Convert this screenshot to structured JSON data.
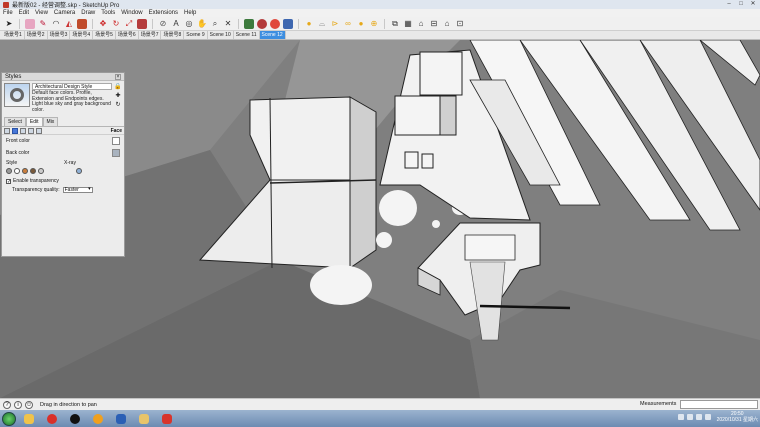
{
  "window": {
    "title": "最新版02 - 经营调整.skp - SketchUp Pro",
    "controls": [
      "–",
      "□",
      "✕"
    ]
  },
  "menu": [
    "File",
    "Edit",
    "View",
    "Camera",
    "Draw",
    "Tools",
    "Window",
    "Extensions",
    "Help"
  ],
  "toolbar": {
    "icons": [
      "select-icon",
      "eraser-icon",
      "pencil-icon",
      "arc-icon",
      "paint-icon",
      "push-pull-icon",
      "move-icon",
      "rotate-icon",
      "scale-icon",
      "offset-icon",
      "tape-icon",
      "text-icon",
      "orbit-icon",
      "pan-icon",
      "zoom-icon",
      "zoom-extents-icon",
      "component-icon",
      "warehouse-icon",
      "extension-icon",
      "iso-view-icon",
      "top-view-icon",
      "front-view-icon",
      "right-view-icon",
      "back-view-icon",
      "left-view-icon"
    ]
  },
  "scenes": {
    "tabs": [
      "场景号1",
      "场景号2",
      "场景号3",
      "场景号4",
      "场景号5",
      "场景号6",
      "场景号7",
      "场景号8",
      "Scene 9",
      "Scene 10",
      "Scene 11",
      "Scene 12"
    ],
    "active_index": 11
  },
  "styles_panel": {
    "header": "Styles",
    "style_name": "Architectural Design Style",
    "style_description": "Default face colors. Profile, Extension and Endpoints edges. Light blue sky and gray background color.",
    "tabs": [
      "Select",
      "Edit",
      "Mix"
    ],
    "active_tab": "Edit",
    "section_label": "Face",
    "front_color_label": "Front color",
    "back_color_label": "Back color",
    "front_color": "#ffffff",
    "back_color": "#a9b3bf",
    "style_label": "Style",
    "xray_label": "X-ray",
    "transparency_label": "Enable transparency",
    "transparency_checked": true,
    "quality_label": "Transparency quality:",
    "quality_value": "Faster"
  },
  "status": {
    "hint": "Drag in direction to pan",
    "measurements_label": "Measurements",
    "measurements_value": ""
  },
  "taskbar": {
    "apps": [
      "explorer",
      "browser-red",
      "qq",
      "orange",
      "word",
      "folder",
      "sketchup"
    ],
    "time": "20:50",
    "date": "2020/10/31 星期六"
  },
  "colors": {
    "viewport_bg": "#7f7f7f",
    "active_tab": "#3d8ee0",
    "face_white": "#ffffff"
  }
}
